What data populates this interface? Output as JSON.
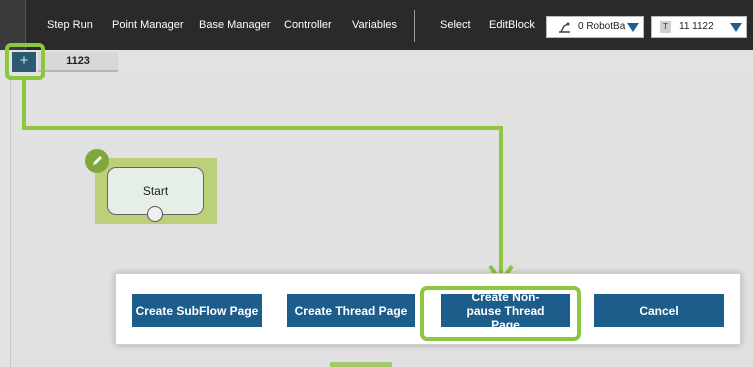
{
  "toolbar": {
    "step_run": "Step Run",
    "point_manager": "Point Manager",
    "base_manager": "Base Manager",
    "controller": "Controller",
    "variables": "Variables",
    "select": "Select",
    "edit_block": "EditBlock",
    "base_dropdown": {
      "value": "0 RobotBa",
      "icon": "robot-base-icon"
    },
    "tool_dropdown": {
      "badge": "T",
      "value": "11 1122"
    }
  },
  "pages": {
    "add_label": "+",
    "tabs": [
      {
        "label": "1123"
      }
    ]
  },
  "flow": {
    "start_node": {
      "label": "Start"
    },
    "edit_icon": "pencil-icon"
  },
  "dialog": {
    "buttons": {
      "subflow": "Create SubFlow Page",
      "thread": "Create Thread Page",
      "nonpause": "Create Non-pause Thread Page",
      "cancel": "Cancel"
    }
  },
  "colors": {
    "toolbar_bg": "#2a2a2a",
    "button_blue": "#1c5d8c",
    "highlight_green": "#8dc63f",
    "canvas_bg": "#e1e1e1",
    "node_selected": "#bccf7a"
  }
}
